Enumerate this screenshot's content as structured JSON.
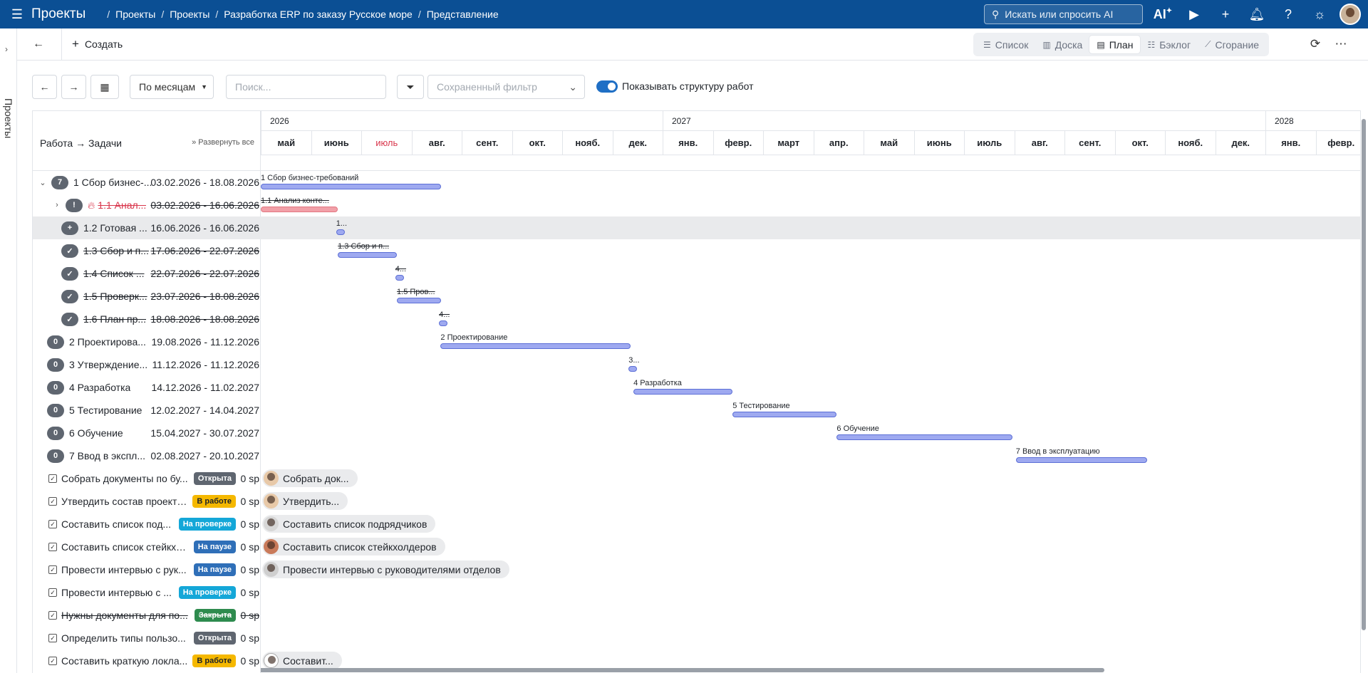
{
  "header": {
    "app_title": "Проекты",
    "breadcrumbs": [
      "Проекты",
      "Проекты",
      "Разработка ERP по заказу Русское море",
      "Представление"
    ],
    "search_placeholder": "Искать или спросить AI",
    "ai_label": "AI"
  },
  "sidebar": {
    "label": "Проекты"
  },
  "actionbar": {
    "create_label": "Создать",
    "views": [
      {
        "label": "Список",
        "icon": "list-icon"
      },
      {
        "label": "Доска",
        "icon": "board-icon"
      },
      {
        "label": "План",
        "icon": "gantt-icon",
        "active": true
      },
      {
        "label": "Бэклог",
        "icon": "backlog-icon"
      },
      {
        "label": "Сгорание",
        "icon": "burndown-icon"
      }
    ]
  },
  "toolbar": {
    "scale_label": "По месяцам",
    "search_placeholder": "Поиск...",
    "saved_filter_placeholder": "Сохраненный фильтр",
    "show_structure_label": "Показывать структуру работ",
    "show_structure_on": true
  },
  "gantt": {
    "left_header": "Работа → Задачи",
    "expand_all": "Развернуть все",
    "years": [
      "2026",
      "2027",
      "2028"
    ],
    "months": [
      "май",
      "июнь",
      "июль",
      "авг.",
      "сент.",
      "окт.",
      "нояб.",
      "дек.",
      "янв.",
      "февр.",
      "март",
      "апр.",
      "май",
      "июнь",
      "июль",
      "авг.",
      "сент.",
      "окт.",
      "нояб.",
      "дек.",
      "янв.",
      "февр."
    ],
    "current_month": "июль",
    "work_rows": [
      {
        "count": "7",
        "expanded": true,
        "name": "1 Сбор бизнес-...",
        "dates": "03.02.2026 - 18.08.2026",
        "bar_label": "1 Сбор бизнес-требований"
      },
      {
        "count": "!",
        "collapsed": true,
        "fire": true,
        "name": "1.1 Анал...",
        "dates": "03.02.2026 - 16.06.2026",
        "bar_label": "1.1 Анализ конте...",
        "strike": true,
        "overdue": true
      },
      {
        "count": "+",
        "name": "1.2 Готовая ...",
        "dates": "16.06.2026 - 16.06.2026",
        "bar_label": "1...",
        "highlight": true
      },
      {
        "count": "✓",
        "name": "1.3 Сбор и п...",
        "dates": "17.06.2026 - 22.07.2026",
        "bar_label": "1.3 Сбор и п...",
        "strike": true
      },
      {
        "count": "✓",
        "name": "1.4 Список ...",
        "dates": "22.07.2026 - 22.07.2026",
        "bar_label": "4...",
        "strike": true
      },
      {
        "count": "✓",
        "name": "1.5 Проверк...",
        "dates": "23.07.2026 - 18.08.2026",
        "bar_label": "1.5 Пров...",
        "strike": true
      },
      {
        "count": "✓",
        "name": "1.6 План пр...",
        "dates": "18.08.2026 - 18.08.2026",
        "bar_label": "4...",
        "strike": true
      },
      {
        "count": "0",
        "name": "2 Проектирова...",
        "dates": "19.08.2026 - 11.12.2026",
        "bar_label": "2 Проектирование"
      },
      {
        "count": "0",
        "name": "3 Утверждение...",
        "dates": "11.12.2026 - 11.12.2026",
        "bar_label": "3..."
      },
      {
        "count": "0",
        "name": "4 Разработка",
        "dates": "14.12.2026 - 11.02.2027",
        "bar_label": "4 Разработка"
      },
      {
        "count": "0",
        "name": "5 Тестирование",
        "dates": "12.02.2027 - 14.04.2027",
        "bar_label": "5 Тестирование"
      },
      {
        "count": "0",
        "name": "6 Обучение",
        "dates": "15.04.2027 - 30.07.2027",
        "bar_label": "6 Обучение"
      },
      {
        "count": "0",
        "name": "7 Ввод в экспл...",
        "dates": "02.08.2027 - 20.10.2027",
        "bar_label": "7 Ввод в эксплуатацию"
      }
    ],
    "task_rows": [
      {
        "name": "Собрать документы по бу...",
        "status": "Открыта",
        "status_color": "#5f6670",
        "sp": "0 sp",
        "chip": "Собрать док..."
      },
      {
        "name": "Утвердить состав проектн...",
        "status": "В работе",
        "status_color": "#f5b800",
        "sp": "0 sp",
        "chip": "Утвердить..."
      },
      {
        "name": "Составить список под...",
        "status": "На проверке",
        "status_color": "#14a7d8",
        "sp": "0 sp",
        "chip": "Составить список подрядчиков"
      },
      {
        "name": "Составить список стейкхо...",
        "status": "На паузе",
        "status_color": "#2f6fb8",
        "sp": "0 sp",
        "chip": "Составить список стейкхолдеров"
      },
      {
        "name": "Провести интервью с рук...",
        "status": "На паузе",
        "status_color": "#2f6fb8",
        "sp": "0 sp",
        "chip": "Провести интервью с руководителями отделов"
      },
      {
        "name": "Провести интервью с ...",
        "status": "На проверке",
        "status_color": "#14a7d8",
        "sp": "0 sp",
        "chip": ""
      },
      {
        "name": "Нужны документы для по...",
        "status": "Закрыта",
        "status_color": "#2e8b4e",
        "sp": "0 sp",
        "chip": "",
        "strike": true
      },
      {
        "name": "Определить типы пользо...",
        "status": "Открыта",
        "status_color": "#5f6670",
        "sp": "0 sp",
        "chip": ""
      },
      {
        "name": "Составить краткую локла...",
        "status": "В работе",
        "status_color": "#f5b800",
        "sp": "0 sp",
        "chip": "Составит..."
      }
    ]
  },
  "colors": {
    "brand": "#0b4f94",
    "accent": "#1f6fc5",
    "bar": "#9ea9f0",
    "overdue": "#d9364c"
  }
}
